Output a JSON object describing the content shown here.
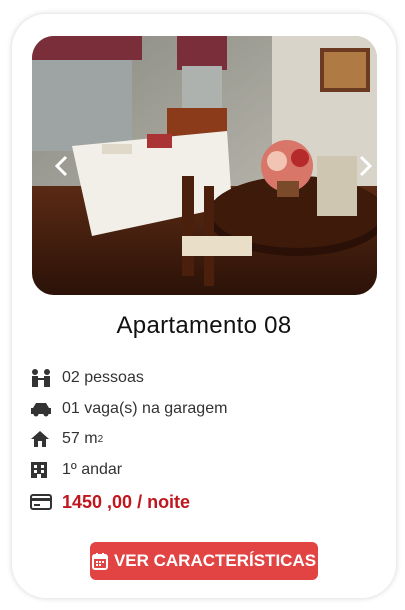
{
  "card": {
    "title": "Apartamento 08",
    "features": [
      {
        "icon": "people-icon",
        "text": "02 pessoas"
      },
      {
        "icon": "car-icon",
        "text": "01 vaga(s) na garagem"
      },
      {
        "icon": "house-icon",
        "text": "57 m",
        "sup": "2"
      },
      {
        "icon": "building-icon",
        "text": "1º andar"
      }
    ],
    "price": {
      "icon": "credit-card-icon",
      "text": "1450 ,00 / noite"
    },
    "button": {
      "icon": "calendar-icon",
      "label": "VER CARACTERÍSTICAS"
    }
  },
  "colors": {
    "accent": "#e24444",
    "price": "#c0161d"
  }
}
